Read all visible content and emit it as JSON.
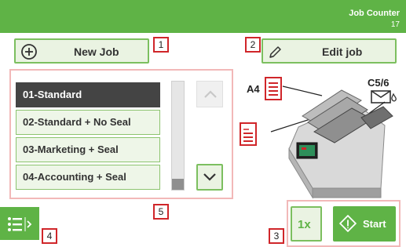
{
  "header": {
    "title": "Job Counter",
    "count": "17"
  },
  "new_job_button": {
    "label": "New Job",
    "icon": "plus-circle-icon"
  },
  "edit_job_button": {
    "label": "Edit job",
    "icon": "pencil-icon"
  },
  "jobs": {
    "items": [
      {
        "label": "01-Standard",
        "selected": true
      },
      {
        "label": "02-Standard + No Seal",
        "selected": false
      },
      {
        "label": "03-Marketing + Seal",
        "selected": false
      },
      {
        "label": "04-Accounting + Seal",
        "selected": false
      }
    ]
  },
  "machine": {
    "doc_label": "A4",
    "envelope_label": "C5/6"
  },
  "callouts": [
    "1",
    "2",
    "3",
    "4",
    "5"
  ],
  "footer": {
    "count_label": "1x",
    "start_label": "Start",
    "menu_icon": "list-menu-icon"
  },
  "colors": {
    "accent_green": "#5fb346",
    "callout_red": "#d0262a",
    "highlight_pink": "#f2b8b8"
  }
}
